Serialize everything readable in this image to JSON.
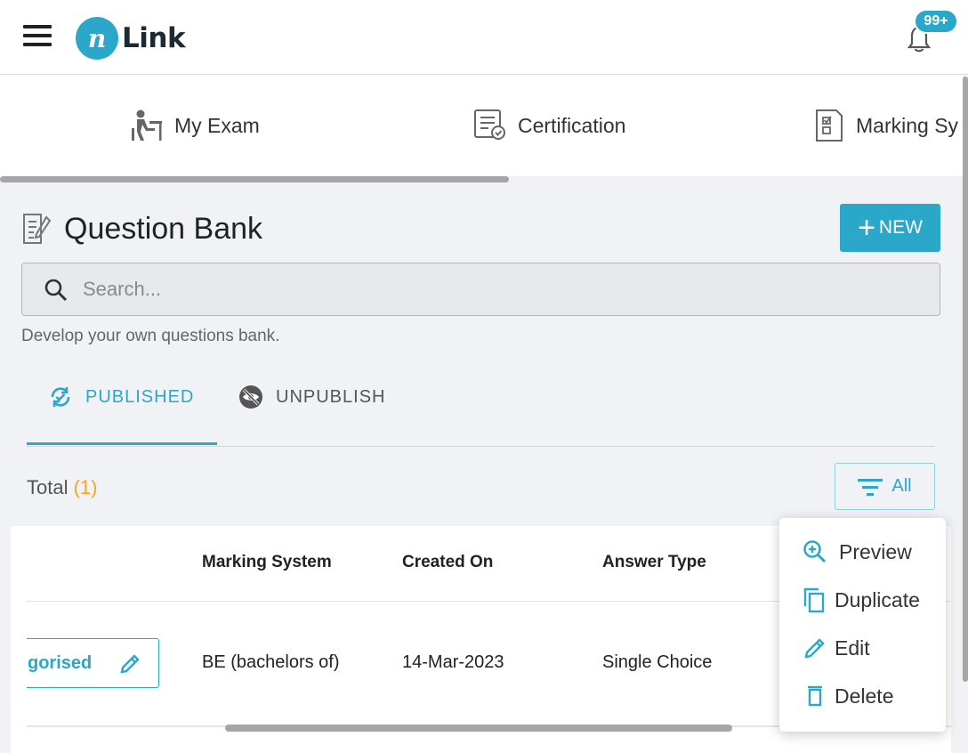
{
  "app": {
    "logo_letter": "n",
    "logo_text": "Link",
    "notification_badge": "99+"
  },
  "nav": {
    "items": [
      {
        "label": "My Exam",
        "icon": "student-desk-icon"
      },
      {
        "label": "Certification",
        "icon": "certificate-icon"
      },
      {
        "label": "Marking Sy",
        "icon": "marking-sheet-icon"
      }
    ]
  },
  "page": {
    "title": "Question Bank",
    "new_button": "NEW",
    "search_placeholder": "Search...",
    "helper_text": "Develop your own questions bank."
  },
  "tabs": [
    {
      "label": "PUBLISHED",
      "active": true,
      "icon": "refresh-check-icon"
    },
    {
      "label": "UNPUBLISH",
      "active": false,
      "icon": "eye-off-icon"
    }
  ],
  "summary": {
    "total_label": "Total",
    "total_count": "(1)",
    "filter_label": "All"
  },
  "table": {
    "columns": [
      "Marking System",
      "Created On",
      "Answer Type"
    ],
    "rows": [
      {
        "category": "gorised",
        "marking_system": "BE (bachelors of)",
        "created_on": "14-Mar-2023",
        "answer_type": "Single Choice"
      }
    ]
  },
  "context_menu": {
    "items": [
      "Preview",
      "Duplicate",
      "Edit",
      "Delete"
    ]
  },
  "colors": {
    "accent": "#2aa7c9",
    "count": "#f5a623",
    "background": "#f1f2f6"
  }
}
